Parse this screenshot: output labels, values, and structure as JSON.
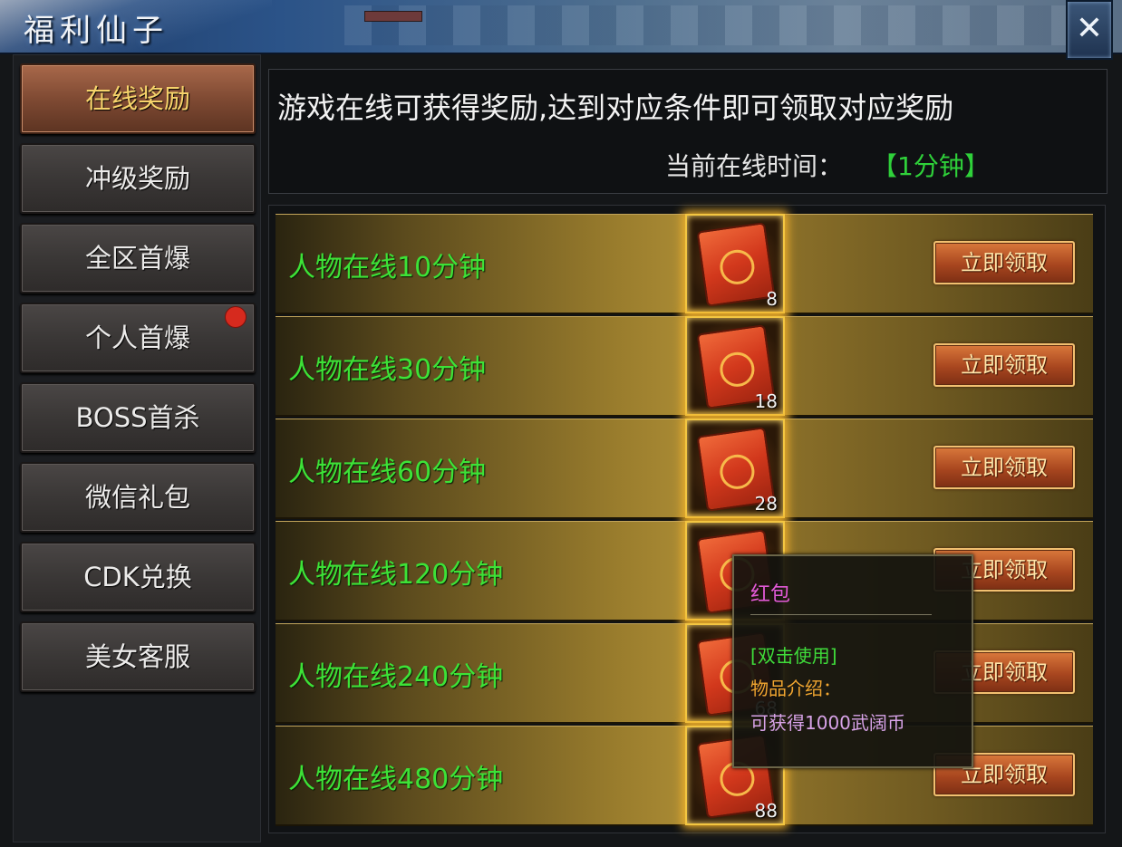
{
  "window": {
    "title": "福利仙子",
    "close_label": "✕"
  },
  "sidebar": {
    "items": [
      {
        "label": "在线奖励",
        "active": true
      },
      {
        "label": "冲级奖励",
        "active": false
      },
      {
        "label": "全区首爆",
        "active": false
      },
      {
        "label": "个人首爆",
        "active": false,
        "notification": true
      },
      {
        "label": "BOSS首杀",
        "active": false
      },
      {
        "label": "微信礼包",
        "active": false
      },
      {
        "label": "CDK兑换",
        "active": false
      },
      {
        "label": "美女客服",
        "active": false
      }
    ]
  },
  "header": {
    "description": "游戏在线可获得奖励,达到对应条件即可领取对应奖励",
    "online_time_label": "当前在线时间：",
    "online_time_value": "【1分钟】"
  },
  "rewards": [
    {
      "label": "人物在线10分钟",
      "item_icon": "red-envelope-icon",
      "count": "8",
      "button": "立即领取"
    },
    {
      "label": "人物在线30分钟",
      "item_icon": "red-envelope-icon",
      "count": "18",
      "button": "立即领取"
    },
    {
      "label": "人物在线60分钟",
      "item_icon": "red-envelope-icon",
      "count": "28",
      "button": "立即领取"
    },
    {
      "label": "人物在线120分钟",
      "item_icon": "red-envelope-icon",
      "count": "",
      "button": "立即领取"
    },
    {
      "label": "人物在线240分钟",
      "item_icon": "red-envelope-icon",
      "count": "68",
      "button": "立即领取"
    },
    {
      "label": "人物在线480分钟",
      "item_icon": "red-envelope-icon",
      "count": "88",
      "button": "立即领取"
    }
  ],
  "tooltip": {
    "name": "红包",
    "usage": "[双击使用]",
    "desc_label": "物品介绍：",
    "desc": "可获得1000武阔币"
  },
  "colors": {
    "active_tab_text": "#f6d36b",
    "reward_label": "#3de237",
    "online_time_value": "#2fd13a",
    "tooltip_name": "#e35ad8",
    "tooltip_desc_label": "#f0a530"
  }
}
